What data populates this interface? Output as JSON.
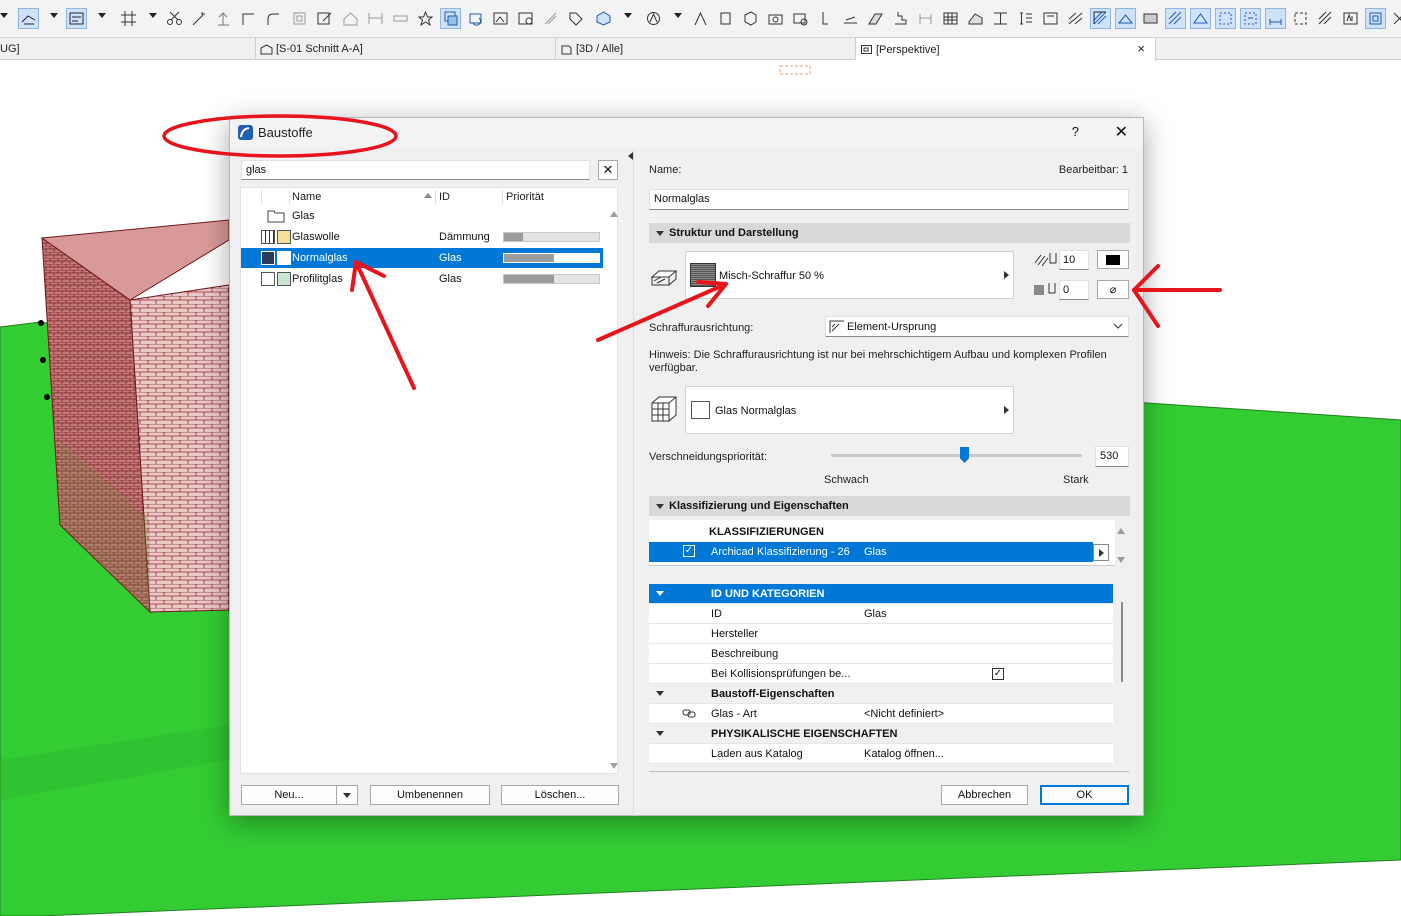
{
  "tabs": [
    {
      "label": "UG]"
    },
    {
      "label": "[S-01 Schnitt A-A]"
    },
    {
      "label": "[3D / Alle]"
    },
    {
      "label": "[Perspektive]"
    }
  ],
  "tab_close": "×",
  "dialog": {
    "title": "Baustoffe",
    "help": "?",
    "close": "✕"
  },
  "left": {
    "search_value": "glas",
    "clear": "✕",
    "columns": {
      "name": "Name",
      "id": "ID",
      "priority": "Priorität"
    },
    "folder": "Glas",
    "rows": [
      {
        "name": "Glaswolle",
        "id": "Dämmung",
        "priority": 0.2
      },
      {
        "name": "Normalglas",
        "id": "Glas",
        "priority": 0.53
      },
      {
        "name": "Profilitglas",
        "id": "Glas",
        "priority": 0.53
      }
    ],
    "buttons": {
      "new": "Neu...",
      "rename": "Umbenennen",
      "delete": "Löschen..."
    }
  },
  "right": {
    "name_label": "Name:",
    "editable_label": "Bearbeitbar: 1",
    "name_value": "Normalglas",
    "section1": "Struktur und Darstellung",
    "hatch": "Misch-Schraffur 50 %",
    "pen_fg": "10",
    "pen_bg": "0",
    "orientation_label": "Schraffurausrichtung:",
    "orientation_value": "Element-Ursprung",
    "note": "Hinweis: Die Schraffurausrichtung ist nur bei mehrschichtigem Aufbau und komplexen Profilen verfügbar.",
    "surface": "Glas Normalglas",
    "priority_label": "Verschneidungspriorität:",
    "priority_value": "530",
    "priority_level": 0.53,
    "weak": "Schwach",
    "strong": "Stark",
    "section2": "Klassifizierung und Eigenschaften",
    "klass_header": "KLASSIFIZIERUNGEN",
    "klass_row": {
      "system": "Archicad Klassifizierung - 26",
      "value": "Glas"
    },
    "props": [
      {
        "key": "ID UND KATEGORIEN",
        "value": "",
        "type": "hl"
      },
      {
        "key": "ID",
        "value": "Glas",
        "type": "row"
      },
      {
        "key": "Hersteller",
        "value": "",
        "type": "row"
      },
      {
        "key": "Beschreibung",
        "value": "",
        "type": "row"
      },
      {
        "key": "Bei Kollisionsprüfungen be...",
        "value": "",
        "type": "check"
      },
      {
        "key": "Baustoff-Eigenschaften",
        "value": "",
        "type": "grp"
      },
      {
        "key": "Glas - Art",
        "value": "<Nicht definiert>",
        "type": "row"
      },
      {
        "key": "PHYSIKALISCHE EIGENSCHAFTEN",
        "value": "",
        "type": "grp"
      },
      {
        "key": "Laden aus Katalog",
        "value": "Katalog öffnen...",
        "type": "row"
      }
    ],
    "cancel": "Abbrechen",
    "ok": "OK"
  },
  "colors": {
    "accent": "#0078d7",
    "annotation": "#e8141c",
    "ground": "#33cc33",
    "brick": "#c46a6a"
  }
}
